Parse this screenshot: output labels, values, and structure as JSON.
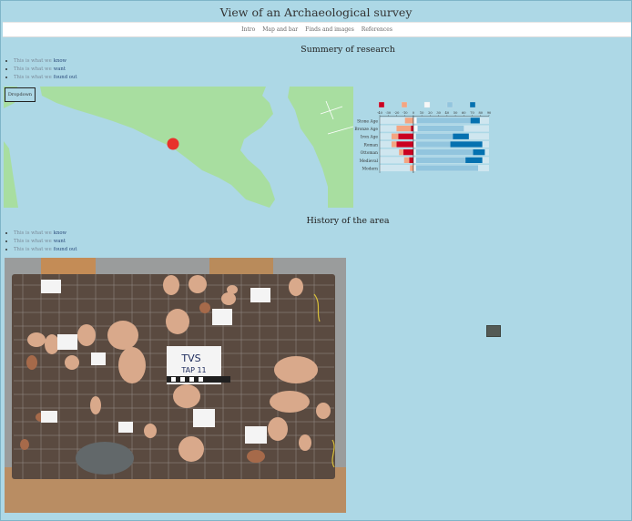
{
  "header": {
    "title": "View of an Archaeological survey"
  },
  "nav": {
    "items": [
      {
        "label": "Intro"
      },
      {
        "label": "Map and bar"
      },
      {
        "label": "Finds and images"
      },
      {
        "label": "References"
      }
    ]
  },
  "summary": {
    "heading": "Summery of research",
    "bullets": [
      {
        "prefix": "This is what we",
        "strong": "know"
      },
      {
        "prefix": "This is what we",
        "strong": "want"
      },
      {
        "prefix": "This is what we",
        "strong": "found out"
      }
    ]
  },
  "map": {
    "dropdown_label": "Dropdown",
    "sea_color": "#add8e6",
    "land_color": "#a8dea0",
    "marker_color": "#e8322b"
  },
  "history": {
    "heading": "History of the area",
    "bullets": [
      {
        "prefix": "This is what we",
        "strong": "know"
      },
      {
        "prefix": "This is what we",
        "strong": "want"
      },
      {
        "prefix": "This is what we",
        "strong": "found out"
      }
    ]
  },
  "photo": {
    "sign_text_1": "TVS",
    "sign_text_2": "TAP 11"
  },
  "thumbnail": {
    "icon": "image-thumbnail-icon"
  },
  "chart_data": {
    "type": "bar",
    "stacked": "diverging",
    "categories": [
      "Stone Age",
      "Bronze Age",
      "Iron Age",
      "Roman",
      "Ottoman",
      "Medieval",
      "Modern"
    ],
    "legend_labels": [
      "",
      "",
      "",
      "",
      ""
    ],
    "colors": [
      "#ca0020",
      "#f4a582",
      "#f7f7f7",
      "#92c5de",
      "#0571b0"
    ],
    "xlim": [
      -40,
      90
    ],
    "xticks": [
      -40,
      -30,
      -20,
      -10,
      0,
      10,
      20,
      30,
      40,
      50,
      60,
      70,
      80,
      90
    ],
    "series": [
      {
        "values": [
          0,
          -3,
          -18,
          -20,
          -12,
          -5,
          0
        ]
      },
      {
        "values": [
          -10,
          -17,
          -8,
          -6,
          -5,
          -6,
          -4
        ]
      },
      {
        "values": [
          4,
          5,
          3,
          3,
          3,
          3,
          3
        ]
      },
      {
        "values": [
          64,
          55,
          44,
          41,
          68,
          59,
          74
        ]
      },
      {
        "values": [
          11,
          0,
          19,
          38,
          14,
          20,
          0
        ]
      }
    ]
  }
}
